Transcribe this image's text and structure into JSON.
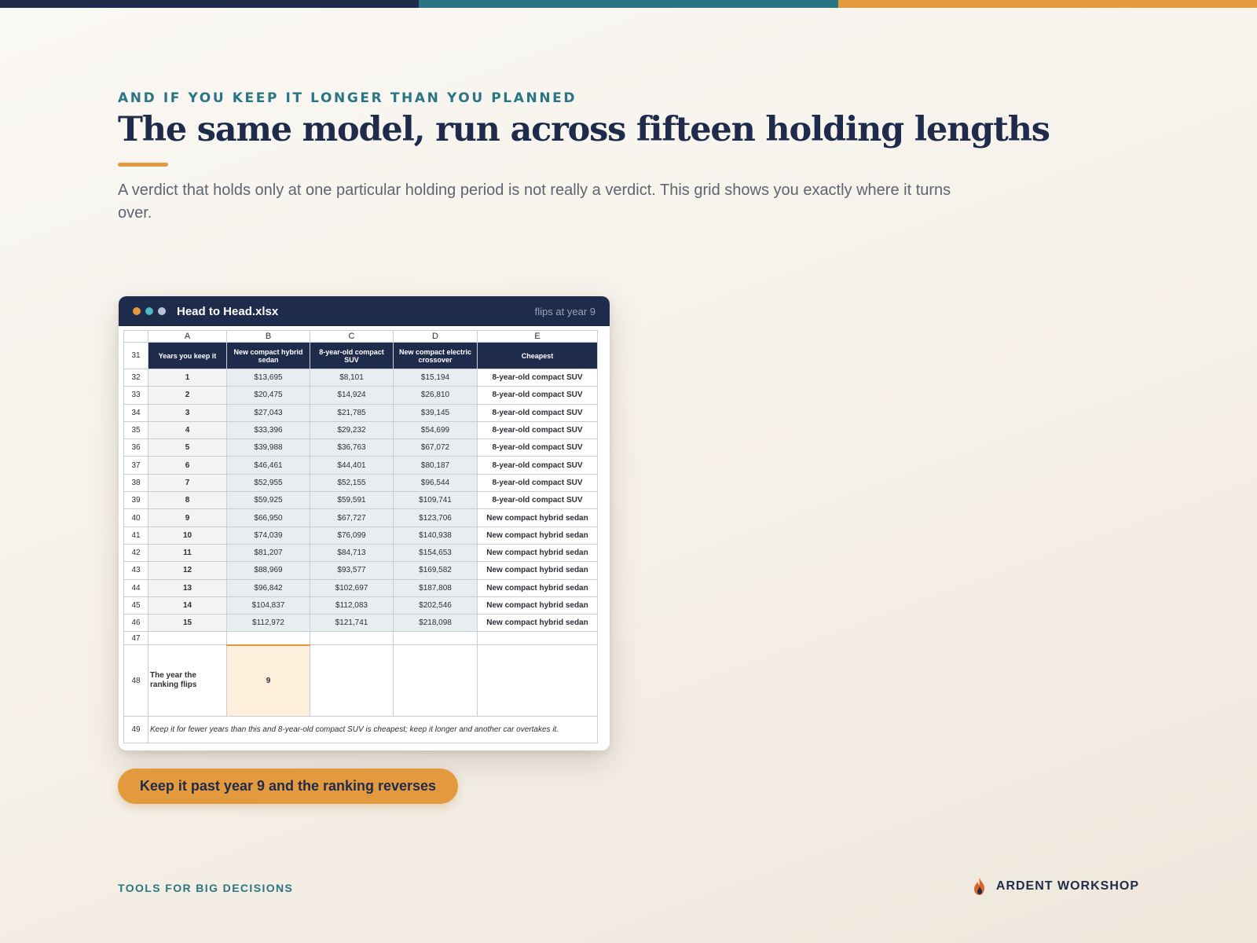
{
  "colors": {
    "navy": "#1e2b4a",
    "teal": "#2a7584",
    "orange": "#e39a3f",
    "dot1": "#e39a3f",
    "dot2": "#4fb8c2",
    "dot3": "#b9c2d6"
  },
  "eyebrow": "AND IF YOU KEEP IT LONGER THAN YOU PLANNED",
  "title": "The same model, run across fifteen holding lengths",
  "subtitle": "A verdict that holds only at one particular holding period is not really a verdict. This grid shows you exactly where it turns over.",
  "window": {
    "filename": "Head to Head.xlsx",
    "status": "flips at year 9"
  },
  "sheet": {
    "columns": [
      "A",
      "B",
      "C",
      "D",
      "E"
    ],
    "header_row_number": "31",
    "headers": [
      "Years you keep it",
      "New compact hybrid sedan",
      "8-year-old compact SUV",
      "New compact electric crossover",
      "Cheapest"
    ],
    "rows": [
      {
        "rownum": "32",
        "year": "1",
        "b": "$13,695",
        "c": "$8,101",
        "d": "$15,194",
        "e": "8-year-old compact SUV"
      },
      {
        "rownum": "33",
        "year": "2",
        "b": "$20,475",
        "c": "$14,924",
        "d": "$26,810",
        "e": "8-year-old compact SUV"
      },
      {
        "rownum": "34",
        "year": "3",
        "b": "$27,043",
        "c": "$21,785",
        "d": "$39,145",
        "e": "8-year-old compact SUV"
      },
      {
        "rownum": "35",
        "year": "4",
        "b": "$33,396",
        "c": "$29,232",
        "d": "$54,699",
        "e": "8-year-old compact SUV"
      },
      {
        "rownum": "36",
        "year": "5",
        "b": "$39,988",
        "c": "$36,763",
        "d": "$67,072",
        "e": "8-year-old compact SUV"
      },
      {
        "rownum": "37",
        "year": "6",
        "b": "$46,461",
        "c": "$44,401",
        "d": "$80,187",
        "e": "8-year-old compact SUV"
      },
      {
        "rownum": "38",
        "year": "7",
        "b": "$52,955",
        "c": "$52,155",
        "d": "$96,544",
        "e": "8-year-old compact SUV"
      },
      {
        "rownum": "39",
        "year": "8",
        "b": "$59,925",
        "c": "$59,591",
        "d": "$109,741",
        "e": "8-year-old compact SUV"
      },
      {
        "rownum": "40",
        "year": "9",
        "b": "$66,950",
        "c": "$67,727",
        "d": "$123,706",
        "e": "New compact hybrid sedan"
      },
      {
        "rownum": "41",
        "year": "10",
        "b": "$74,039",
        "c": "$76,099",
        "d": "$140,938",
        "e": "New compact hybrid sedan"
      },
      {
        "rownum": "42",
        "year": "11",
        "b": "$81,207",
        "c": "$84,713",
        "d": "$154,653",
        "e": "New compact hybrid sedan"
      },
      {
        "rownum": "43",
        "year": "12",
        "b": "$88,969",
        "c": "$93,577",
        "d": "$169,582",
        "e": "New compact hybrid sedan"
      },
      {
        "rownum": "44",
        "year": "13",
        "b": "$96,842",
        "c": "$102,697",
        "d": "$187,808",
        "e": "New compact hybrid sedan"
      },
      {
        "rownum": "45",
        "year": "14",
        "b": "$104,837",
        "c": "$112,083",
        "d": "$202,546",
        "e": "New compact hybrid sedan"
      },
      {
        "rownum": "46",
        "year": "15",
        "b": "$112,972",
        "c": "$121,741",
        "d": "$218,098",
        "e": "New compact hybrid sedan"
      }
    ],
    "blank_row_number": "47",
    "flip_row_number": "48",
    "flip_label": "The year the ranking flips",
    "flip_value": "9",
    "note_row_number": "49",
    "note": "Keep it for fewer years than this and 8-year-old compact SUV is cheapest; keep it longer and another car overtakes it."
  },
  "callout": "Keep it past year 9 and the ranking reverses",
  "footer": {
    "left": "TOOLS FOR BIG DECISIONS",
    "brand": "ARDENT WORKSHOP",
    "brand_icon": "flame-icon"
  }
}
